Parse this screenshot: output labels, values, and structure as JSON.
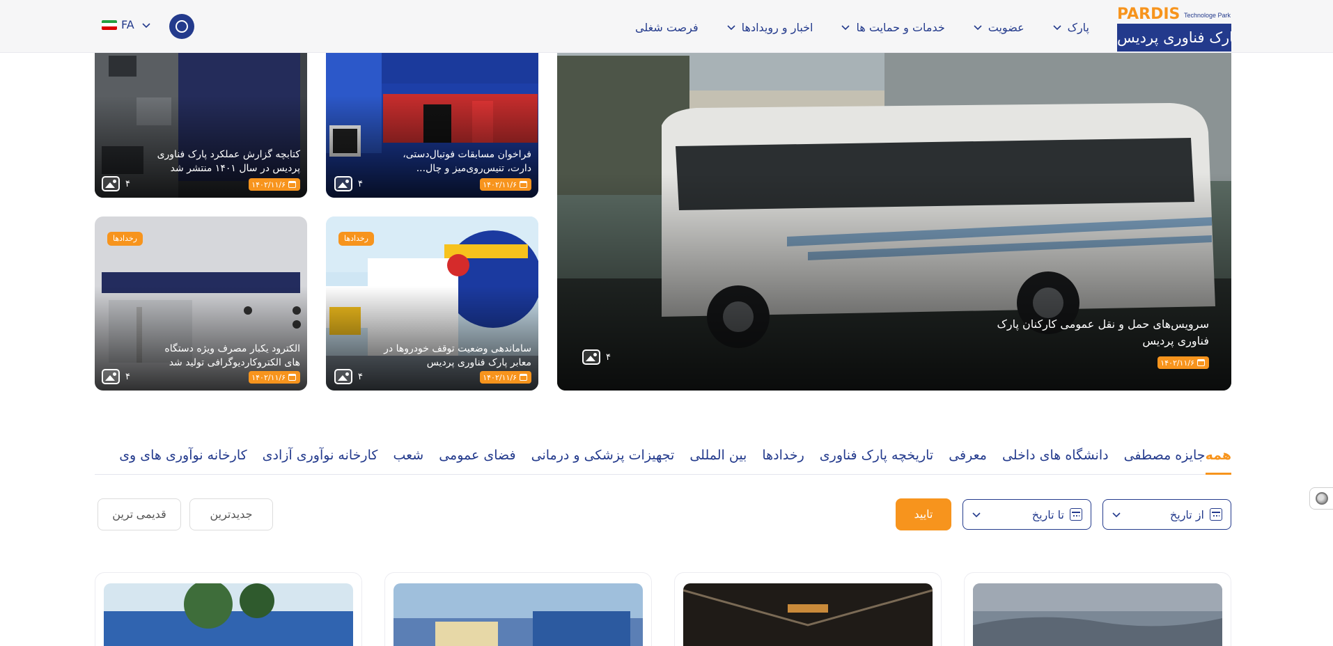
{
  "header": {
    "logo": {
      "brand": "PARDIS",
      "sub": "Technologe Park",
      "persian": "پارک فناوری پردیس"
    },
    "nav": [
      {
        "label": "پارک",
        "dropdown": true
      },
      {
        "label": "عضویت",
        "dropdown": true
      },
      {
        "label": "خدمات و حمایت ها",
        "dropdown": true
      },
      {
        "label": "اخبار و رویدادها",
        "dropdown": true
      },
      {
        "label": "فرصت شغلی",
        "dropdown": false
      }
    ],
    "lang": "FA",
    "search_icon": "search-icon"
  },
  "featured": {
    "title": "سرویس‌های حمل و نقل عمومی کارکنان پارک فناوری پردیس",
    "date": "۱۴۰۲/۱۱/۶",
    "images": "۴"
  },
  "cards": [
    {
      "title": "فراخوان مسابقات فوتبال‌دستی، دارت، تنیس‌روی‌میز و چال...",
      "date": "۱۴۰۲/۱۱/۶",
      "images": "۴"
    },
    {
      "title": "کتابچه گزارش عملکرد پارک فناوری پردیس در سال ۱۴۰۱ منتشر شد",
      "date": "۱۴۰۲/۱۱/۶",
      "images": "۴"
    },
    {
      "title": "ساماندهی وضعیت توقف خودروها در معابر پارک فناوری پردیس",
      "date": "۱۴۰۲/۱۱/۶",
      "images": "۴",
      "tag": "رخدادها"
    },
    {
      "title": "الکترود یکبار مصرف ویژه دستگاه های الکتروکاردیوگرافی تولید شد",
      "date": "۱۴۰۲/۱۱/۶",
      "images": "۴",
      "tag": "رخدادها"
    }
  ],
  "tabs": [
    "همه",
    "جایزه مصطفی",
    "دانشگاه های داخلی",
    "معرفی",
    "تاریخچه پارک فناوری",
    "رخدادها",
    "بین المللی",
    "تجهیزات پزشکی و درمانی",
    "فضای عمومی",
    "شعب",
    "کارخانه نوآوری آزادی",
    "کارخانه نوآوری های وی"
  ],
  "filters": {
    "from_label": "از تاریخ",
    "to_label": "تا تاریخ",
    "confirm": "تایید",
    "newest": "جدیدترین",
    "oldest": "قدیمی ترین"
  },
  "colors": {
    "primary": "#233a8c",
    "accent": "#f7941d"
  }
}
